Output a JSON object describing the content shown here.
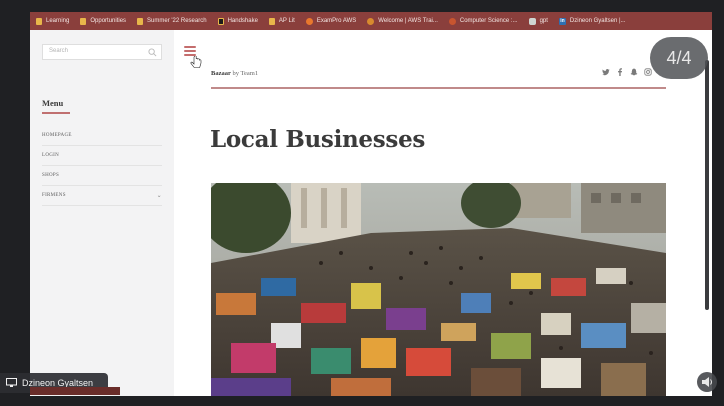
{
  "bookmarks": [
    {
      "label": "Learning",
      "icon": "folder-icon"
    },
    {
      "label": "Opportunities",
      "icon": "folder-icon"
    },
    {
      "label": "Summer '22 Research",
      "icon": "folder-icon"
    },
    {
      "label": "Handshake",
      "icon": "handshake-icon"
    },
    {
      "label": "AP Lit",
      "icon": "folder-icon"
    },
    {
      "label": "ExamPro AWS",
      "icon": "exampro-icon"
    },
    {
      "label": "Welcome | AWS Trai...",
      "icon": "aws-icon"
    },
    {
      "label": "Computer Science :...",
      "icon": "cs-icon"
    },
    {
      "label": "gpt",
      "icon": "gpt-icon"
    },
    {
      "label": "Dzineon Gyaltsen |...",
      "icon": "linkedin-icon"
    }
  ],
  "sidebar": {
    "search_placeholder": "Search",
    "menu_title": "Menu",
    "items": [
      {
        "label": "HOMEPAGE"
      },
      {
        "label": "LOGIN"
      },
      {
        "label": "SHOPS"
      },
      {
        "label": "FIRMENS"
      }
    ]
  },
  "header": {
    "brand": "Bazaar",
    "by": "by Team1",
    "social_icons": [
      "twitter-icon",
      "facebook-icon",
      "snapchat-icon",
      "instagram-icon"
    ]
  },
  "main": {
    "title": "Local Businesses"
  },
  "overlay": {
    "slide_counter": "4/4",
    "presenter_name": "Dzineon Gyaltsen"
  },
  "colors": {
    "bookmark_bar": "#8a3f3c",
    "accent": "#c46d6d"
  }
}
